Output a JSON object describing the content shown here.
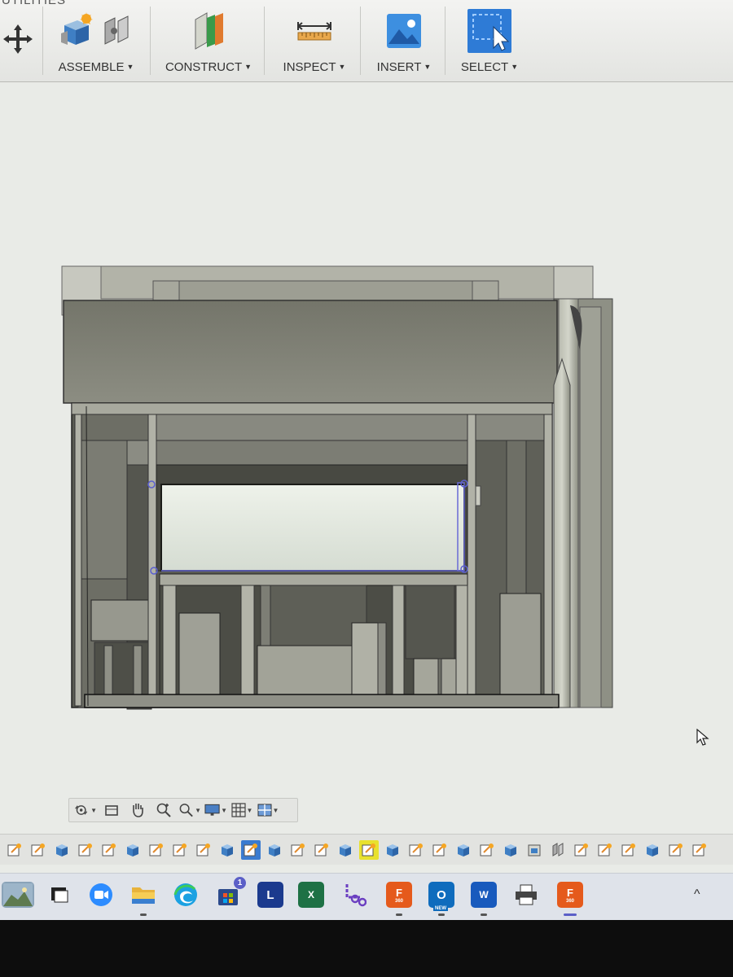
{
  "ribbon": {
    "tab_partial": "UTILITIES",
    "groups": [
      {
        "label": "ASSEMBLE",
        "icon": "assemble-icon"
      },
      {
        "label": "CONSTRUCT",
        "icon": "construct-plane-icon"
      },
      {
        "label": "INSPECT",
        "icon": "measure-icon"
      },
      {
        "label": "INSERT",
        "icon": "insert-image-icon"
      },
      {
        "label": "SELECT",
        "icon": "select-cursor-icon"
      }
    ],
    "dropdown_glyph": "▼"
  },
  "navbar": {
    "buttons": [
      "orbit-icon",
      "look-at-icon",
      "pan-icon",
      "zoom-window-icon",
      "zoom-icon",
      "display-settings-icon",
      "grid-settings-icon",
      "viewports-icon"
    ]
  },
  "timeline": {
    "item_count": 32,
    "item_types": [
      "sketch",
      "sketch",
      "body",
      "sketch",
      "sketch",
      "body",
      "sketch",
      "sketch",
      "sketch",
      "body",
      "active-sketch",
      "body",
      "sketch",
      "sketch",
      "body",
      "highlighted-sketch",
      "body",
      "sketch",
      "sketch",
      "body",
      "sketch",
      "body",
      "component",
      "joint",
      "sketch",
      "sketch",
      "sketch",
      "body",
      "sketch",
      "sketch"
    ]
  },
  "taskbar": {
    "apps": [
      {
        "name": "widgets",
        "label": ""
      },
      {
        "name": "task-view",
        "label": ""
      },
      {
        "name": "zoom",
        "label": ""
      },
      {
        "name": "file-explorer",
        "label": ""
      },
      {
        "name": "edge",
        "label": ""
      },
      {
        "name": "microsoft-store",
        "label": "",
        "badge": "1"
      },
      {
        "name": "lightroom",
        "label": "L"
      },
      {
        "name": "excel",
        "label": "X"
      },
      {
        "name": "snipping-tool",
        "label": ""
      },
      {
        "name": "fusion-360",
        "label": "F",
        "sublabel": "360"
      },
      {
        "name": "outlook-new",
        "label": "O",
        "sublabel": "NEW"
      },
      {
        "name": "word",
        "label": "W"
      },
      {
        "name": "printer",
        "label": ""
      },
      {
        "name": "fusion-360-active",
        "label": "F",
        "sublabel": "360"
      }
    ],
    "tray_chevron": "^"
  },
  "colors": {
    "model_dark": "#6c6d64",
    "model_light": "#b6b7aa",
    "glass": "#dfe4dc",
    "accent_blue": "#2e7bd6",
    "timeline_highlight": "#e8e12e"
  }
}
